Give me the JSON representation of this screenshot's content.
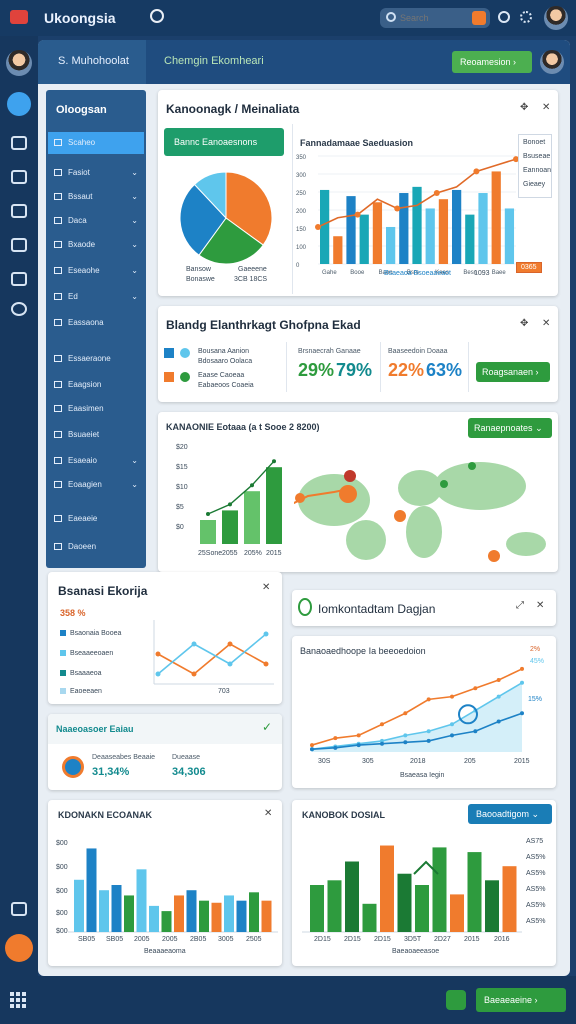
{
  "app": {
    "title": "Ukoongsia"
  },
  "search": {
    "placeholder": "Search"
  },
  "header": {
    "tabs": [
      "S. Muhohoolat",
      "Chemgin Ekomheari"
    ],
    "button": "Reoamesion"
  },
  "sidebar": {
    "heading": "Oloogsan",
    "items": [
      "Scaheo",
      "Fasiot",
      "Bssaut",
      "Daca",
      "Bxaode",
      "Eseaohe",
      "Ed",
      "Eassaona",
      "Essaeraone",
      "Eaagsion",
      "Eaasimen",
      "Bsuaeiet",
      "Esaeaio",
      "Eoaagien",
      "Eaeaeie",
      "Daoeen"
    ]
  },
  "colors": {
    "green": "#2e9b3e",
    "orange": "#f07b2d",
    "blue": "#1d82c6",
    "teal": "#128a8e",
    "lightblue": "#5fc6ec"
  },
  "cards": {
    "c1": {
      "title": "Kanoonagk / Meinaliata",
      "pie_button": "Bannc Eanoaesnons",
      "pie_labels": [
        "Bansow",
        "Gaeeene",
        "Bonaswe",
        "3CB 18CS"
      ],
      "chart_title": "Fannadamaae Saeduasion",
      "legend": [
        "Bonoet",
        "Bsuseae",
        "Eannoan",
        "Gieaey"
      ],
      "xlabels": [
        "Gahe",
        "Booe",
        "Baon",
        "Bsrs",
        "Kaes",
        "Besn",
        "Baee"
      ],
      "highlight": "0365",
      "pct_label": "1093"
    },
    "c2": {
      "title": "Blandg Elanthrkagt Ghofpna Ekad",
      "left_lines": [
        "Bousana Aanion",
        "Bdosaaro Oolaca",
        "Eaase Caoeaa",
        "Eabaeoos Coaeia"
      ],
      "stat1_label": "Brsnaecrah Ganaae",
      "stat1_value_a": "29%",
      "stat1_value_b": "79%",
      "stat2_label": "Baaseedoin Doaaa",
      "stat2_value_a": "22%",
      "stat2_value_b": "63%",
      "button": "Roagsanaen"
    },
    "c3": {
      "title": "KANAONIE Eotaaa (a t Sooe 2 8200)",
      "button": "Ranaepnoates",
      "xlabels": [
        "25Sone",
        "2055",
        "205%",
        "2015"
      ],
      "yvalues": [
        "$20",
        "$15",
        "$10",
        "$5",
        "$0"
      ]
    },
    "c4": {
      "title": "Bsanasi Ekorija",
      "pct": "358 %",
      "legend": [
        "Bsaonaia Booea",
        "Bseaaeeoaen",
        "Bsaaaeoa",
        "Eaoeeaen"
      ],
      "x_label": "703"
    },
    "c5": {
      "title": "Iomkontadtam Dagjan",
      "chart_title": "Banaoaedhoope Ia beeoedoion",
      "val_a": "2%",
      "val_b": "15%",
      "val_c": "45%",
      "xlabels": [
        "30S",
        "305",
        "2018",
        "205",
        "2015"
      ],
      "legend_bottom": "Bsaeasa Iegin"
    },
    "c6": {
      "title": "Naaeoasoer Eaiau",
      "stat1_label": "Deaaseabes Beaaie",
      "stat1_value": "31,34%",
      "stat2_label": "Dueaase",
      "stat2_value": "34,306"
    },
    "c7": {
      "title": "KDONAKN ECOANAK",
      "xlabels": [
        "SB05",
        "SB05",
        "2005",
        "2005",
        "2B05",
        "3005",
        "2505"
      ],
      "xtitle": "Beaaaeaoma",
      "yvalues": [
        "$00",
        "$00",
        "$00",
        "$00",
        "$00"
      ]
    },
    "c8": {
      "title": "KANOBOK DOSIAL",
      "button": "Baooadtigom",
      "xlabels": [
        "2D15",
        "2D15",
        "2D15",
        "3D5T",
        "2D27",
        "2015",
        "2016"
      ],
      "xtitle": "Baeaoaeeasoe",
      "right_labels": [
        "AS75",
        "AS5%",
        "AS5%",
        "AS5%",
        "AS5%",
        "AS5%"
      ]
    }
  },
  "bottom": {
    "button": "Baeaeaeine"
  },
  "chart_data": [
    {
      "type": "pie",
      "categories": [
        "A",
        "B",
        "C",
        "D"
      ],
      "values": [
        35,
        25,
        28,
        12
      ],
      "colors": [
        "#f07b2d",
        "#2e9b3e",
        "#1d82c6",
        "#5fc6ec"
      ]
    },
    {
      "type": "bar",
      "categories": [
        "1",
        "2",
        "3",
        "4",
        "5",
        "6",
        "7",
        "8",
        "9",
        "10",
        "11",
        "12",
        "13",
        "14",
        "15"
      ],
      "values": [
        240,
        90,
        220,
        160,
        200,
        120,
        230,
        250,
        180,
        210,
        240,
        160,
        230,
        300,
        180
      ],
      "colors": [
        "#19a7b6",
        "#f07b2d",
        "#1d82c6",
        "#19a7b6",
        "#f07b2d",
        "#5fc6ec",
        "#1d82c6",
        "#19a7b6",
        "#5fc6ec",
        "#f07b2d",
        "#1d82c6",
        "#19a7b6",
        "#5fc6ec",
        "#f07b2d",
        "#5fc6ec"
      ],
      "line": [
        120,
        150,
        160,
        210,
        180,
        190,
        230,
        250,
        300,
        320,
        340
      ],
      "ylim": [
        0,
        350
      ],
      "ylabels": [
        "350",
        "300",
        "250",
        "200",
        "150",
        "100",
        "0"
      ]
    },
    {
      "type": "bar",
      "categories": [
        "2013",
        "2014",
        "2015",
        "2016"
      ],
      "values": [
        5,
        7,
        11,
        16
      ],
      "ylim": [
        0,
        20
      ]
    },
    {
      "type": "line",
      "series": [
        {
          "values": [
            30,
            10,
            40,
            20
          ],
          "color": "#f07b2d"
        },
        {
          "values": [
            10,
            40,
            20,
            50
          ],
          "color": "#5fc6ec"
        }
      ]
    },
    {
      "type": "line",
      "series": [
        {
          "values": [
            5,
            10,
            12,
            20,
            28,
            38,
            40,
            46,
            52,
            60
          ],
          "color": "#f07b2d"
        },
        {
          "values": [
            2,
            4,
            6,
            8,
            12,
            15,
            20,
            30,
            40,
            50
          ],
          "color": "#5fc6ec"
        },
        {
          "values": [
            2,
            3,
            5,
            6,
            7,
            8,
            12,
            15,
            22,
            28
          ],
          "color": "#1d82c6"
        }
      ],
      "ylim": [
        0,
        65
      ]
    },
    {
      "type": "bar",
      "categories": [
        "1",
        "2",
        "3",
        "4",
        "5",
        "6",
        "7",
        "8",
        "9",
        "10",
        "11",
        "12",
        "13",
        "14",
        "15",
        "16"
      ],
      "values": [
        50,
        80,
        40,
        45,
        35,
        60,
        25,
        20,
        35,
        40,
        30,
        28,
        35,
        30,
        38,
        30
      ],
      "colors": [
        "#5fc6ec",
        "#1d82c6",
        "#5fc6ec",
        "#1d82c6",
        "#2e9b3e",
        "#5fc6ec",
        "#5fc6ec",
        "#2e9b3e",
        "#f07b2d",
        "#1d82c6",
        "#2e9b3e",
        "#f07b2d",
        "#5fc6ec",
        "#1d82c6",
        "#2e9b3e",
        "#f07b2d"
      ],
      "ylim": [
        0,
        90
      ]
    },
    {
      "type": "bar",
      "categories": [
        "1",
        "2",
        "3",
        "4",
        "5",
        "6",
        "7",
        "8",
        "9",
        "10",
        "11",
        "12"
      ],
      "values": [
        50,
        55,
        75,
        30,
        92,
        62,
        50,
        90,
        40,
        85,
        55,
        70
      ],
      "colors": [
        "#2e9b3e",
        "#2e9b3e",
        "#1b7a34",
        "#2e9b3e",
        "#f07b2d",
        "#1b7a34",
        "#2e9b3e",
        "#2e9b3e",
        "#f07b2d",
        "#2e9b3e",
        "#1b7a34",
        "#f07b2d"
      ],
      "ylim": [
        0,
        100
      ]
    }
  ]
}
